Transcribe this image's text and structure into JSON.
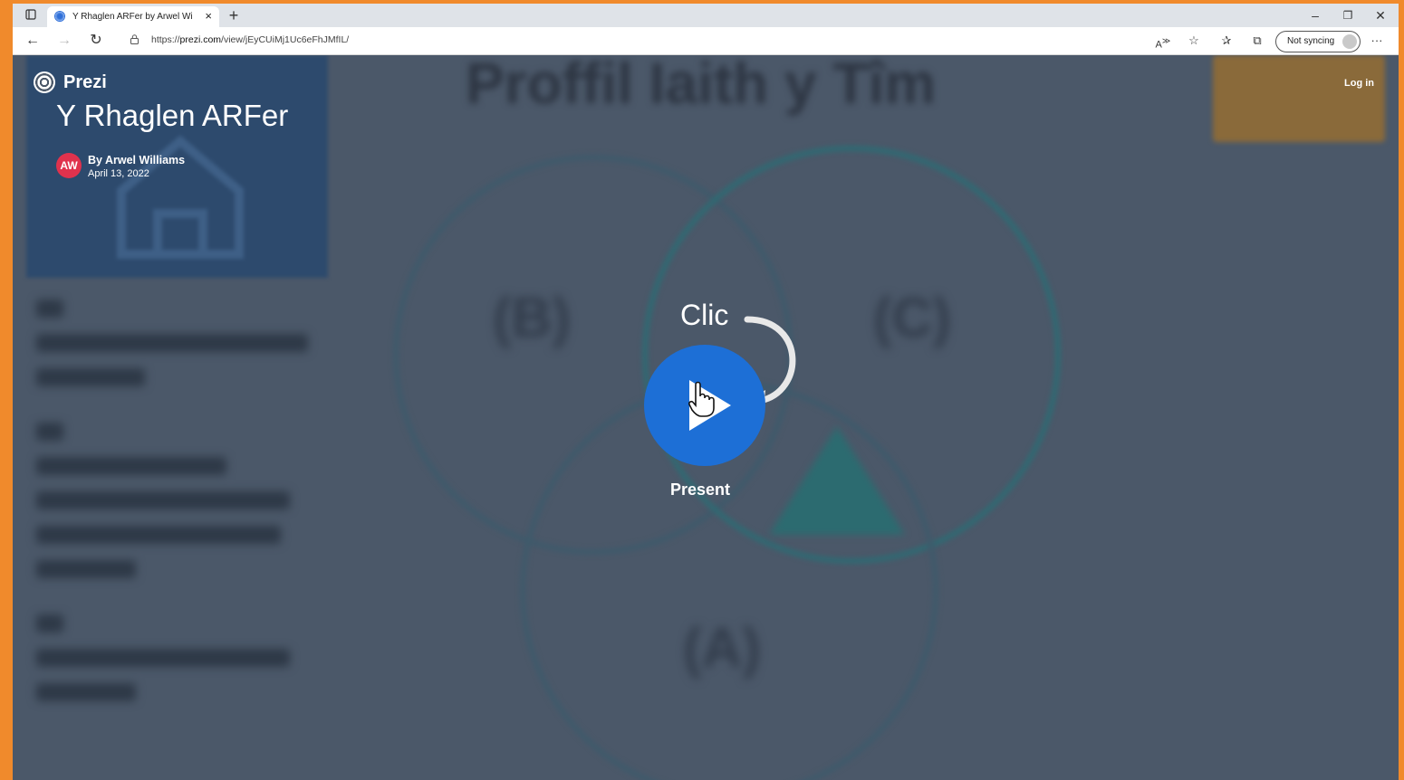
{
  "browser": {
    "tab_title": "Y Rhaglen ARFer by Arwel William",
    "new_tab": "+",
    "url_prefix": "https://",
    "url_domain": "prezi.com",
    "url_path": "/view/jEyCUiMj1Uc6eFhJMfIL/",
    "sync_label": "Not syncing",
    "window_controls": [
      "minimize-icon",
      "restore-icon",
      "close-icon"
    ],
    "toolbar_icons": [
      "read-aloud-icon",
      "add-favorite-icon",
      "favorites-icon",
      "collections-icon",
      "more-icon"
    ]
  },
  "page": {
    "logo_text": "Prezi",
    "presentation_title": "Y Rhaglen ARFer",
    "author_initials": "AW",
    "author_name": "By Arwel Williams",
    "date": "April 13, 2022",
    "login_label": "Log in",
    "overlay_hint": "Clic",
    "present_label": "Present"
  },
  "background_preview": {
    "heading": "Proffil Iaith y Tîm",
    "labels": [
      "(B)",
      "(C)",
      "(A)"
    ]
  },
  "colors": {
    "border": "#f08a2c",
    "overlay": "#4b5869",
    "play_button": "#1d6fd6",
    "avatar": "#e0324d"
  }
}
